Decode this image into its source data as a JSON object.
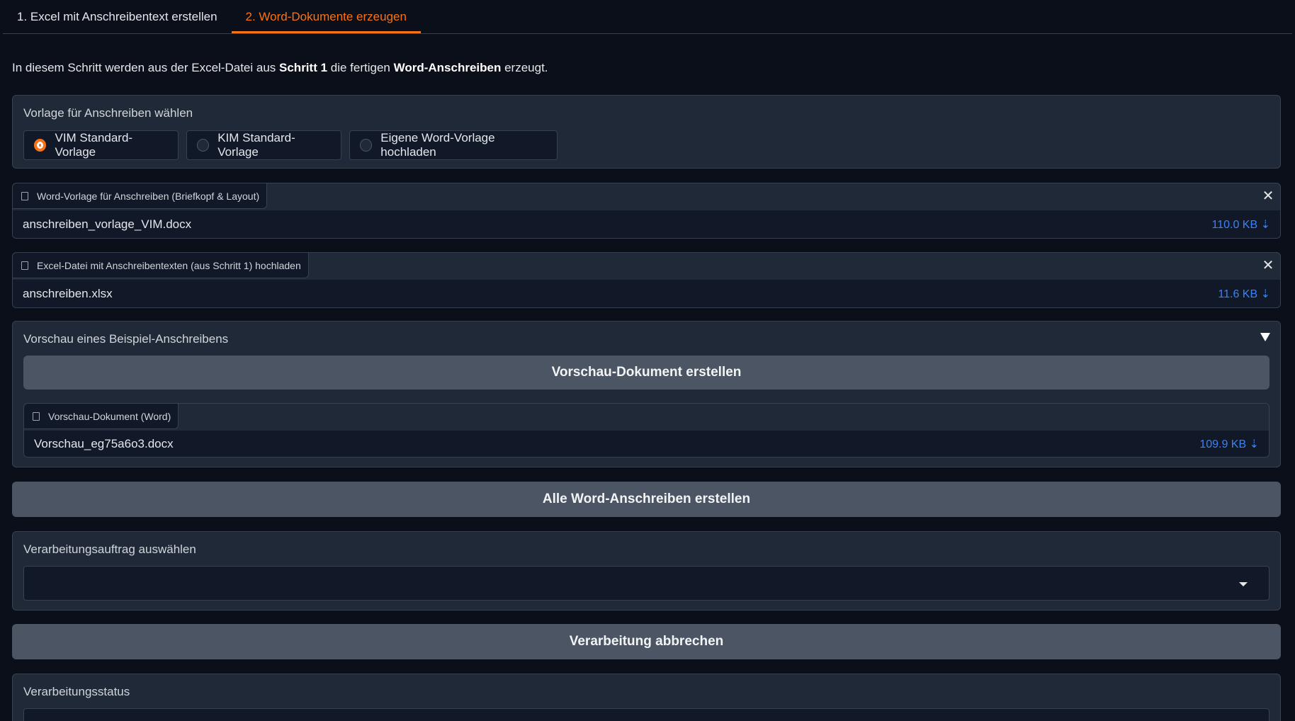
{
  "tabs": [
    {
      "label": "1. Excel mit Anschreibentext erstellen",
      "active": false
    },
    {
      "label": "2. Word-Dokumente erzeugen",
      "active": true
    }
  ],
  "intro": {
    "part1": "In diesem Schritt werden aus der Excel-Datei aus ",
    "bold1": "Schritt 1",
    "part2": " die fertigen ",
    "bold2": "Word-Anschreiben",
    "part3": " erzeugt."
  },
  "template_choice": {
    "label": "Vorlage für Anschreiben wählen",
    "options": [
      {
        "label": "VIM Standard-Vorlage",
        "selected": true
      },
      {
        "label": "KIM Standard-Vorlage",
        "selected": false
      },
      {
        "label": "Eigene Word-Vorlage hochladen",
        "selected": false
      }
    ]
  },
  "word_template_file": {
    "tag": "Word-Vorlage für Anschreiben (Briefkopf & Layout)",
    "filename": "anschreiben_vorlage_VIM.docx",
    "size": "110.0 KB ⇣"
  },
  "excel_file": {
    "tag": "Excel-Datei mit Anschreibentexten (aus Schritt 1) hochladen",
    "filename": "anschreiben.xlsx",
    "size": "11.6 KB ⇣"
  },
  "preview": {
    "label": "Vorschau eines Beispiel-Anschreibens",
    "button": "Vorschau-Dokument erstellen",
    "file_tag": "Vorschau-Dokument (Word)",
    "filename": "Vorschau_eg75a6o3.docx",
    "size": "109.9 KB ⇣"
  },
  "create_all_button": "Alle Word-Anschreiben erstellen",
  "job_select": {
    "label": "Verarbeitungsauftrag auswählen",
    "value": ""
  },
  "cancel_button": "Verarbeitung abbrechen",
  "status": {
    "label": "Verarbeitungsstatus"
  },
  "colors": {
    "accent": "#f97316",
    "link": "#3b82f6",
    "background": "#0b0f19",
    "panel": "#1f2937",
    "button": "#4b5563"
  }
}
